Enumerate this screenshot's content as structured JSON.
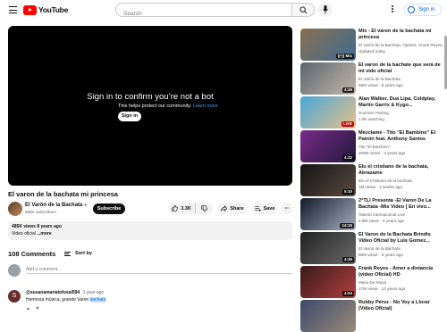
{
  "header": {
    "logo_text": "YouTube",
    "search_placeholder": "Search",
    "signin_label": "Sign in"
  },
  "player": {
    "title": "Sign in to confirm you’re not a bot",
    "message": "This helps protect our community.",
    "learn_more": "Learn more",
    "signin_label": "Sign in"
  },
  "video": {
    "title": "El varon de la bachata mi princesa",
    "channel": "El Varón de la Bachata",
    "subscribers": "566K subscribers",
    "subscribe_label": "Subscribe",
    "likes": "3.3K",
    "share_label": "Share",
    "save_label": "Save",
    "views_date": "485K views  8 years ago",
    "description": "Video oficial",
    "more_label": "...more"
  },
  "comments": {
    "count_label": "108 Comments",
    "sort_label": "Sort by",
    "add_placeholder": "Add a comment...",
    "first": {
      "avatar_letter": "S",
      "author": "@susanamariatofosal594",
      "time": "1 year ago",
      "text": "Hermosa música, grande Varon",
      "highlight": "bachata"
    }
  },
  "recommendations": [
    {
      "title": "Mix - El varon de la bachata mi princesa",
      "channel": "El Varón de la Bachata, Optimiz, Frank Reyes, and more",
      "meta": "Updated today",
      "duration": "((•)) Mix",
      "live": false,
      "colors": [
        "#8a6f52",
        "#3d6b8f"
      ]
    },
    {
      "title": "El varon de la bachate que será de mi vido oficial",
      "channel": "El Varón de la Bachata",
      "meta": "89M views · 9 years ago",
      "duration": "4:39",
      "live": false,
      "colors": [
        "#5a6470",
        "#c5b8a6"
      ]
    },
    {
      "title": "Alan Walker, Dua Lipa, Coldplay, Martin Garrix & Kygo...",
      "channel": "Summer Feeling",
      "meta": "1.9K watching",
      "duration": "LIVE",
      "live": true,
      "colors": [
        "#49a7d8",
        "#e6c08a"
      ]
    },
    {
      "title": "Mézclame - Tito \"El Bambino\" El Patrón feat. Anthony Santos",
      "channel": "Tito \"El Bambino\"",
      "meta": "308M views · 4 years ago",
      "duration": "4:32",
      "live": false,
      "colors": [
        "#7a2a8a",
        "#20193a"
      ]
    },
    {
      "title": "Elu el cristiano de la bachata, Abrazame",
      "channel": "Elu el Cristiano de la bachata",
      "meta": "1M views · 2 weeks ago",
      "duration": "5:10",
      "live": false,
      "colors": [
        "#141414",
        "#5a4a40"
      ]
    },
    {
      "title": "2°TLI Presenta -El Varon De La Bachata -Mis Video [ En vivo...",
      "channel": "Talento Internacional Live",
      "meta": "4.9M views · 9 years ago",
      "duration": "14:15",
      "live": false,
      "colors": [
        "#101a2a",
        "#a8b0c0"
      ]
    },
    {
      "title": "El Varon de la Bachata Brindis Video Oficial by Luis Gomez...",
      "channel": "El Varón de la Bachata",
      "meta": "85M views · 8 years ago",
      "duration": "4:35",
      "live": false,
      "colors": [
        "#222222",
        "#6a6a6a"
      ]
    },
    {
      "title": "Frank Reyes - Amor a distancia (video Oficial) HD",
      "channel": "Mario De Moya",
      "meta": "17M views · 13 years ago",
      "duration": "4:04",
      "live": false,
      "colors": [
        "#3a1a1a",
        "#b04040"
      ]
    },
    {
      "title": "Rubby Pérez - No Voy a Llorar (Video Oficial)",
      "channel": "",
      "meta": "",
      "duration": "",
      "live": false,
      "colors": [
        "#3a4a6a",
        "#9a8a7a"
      ]
    }
  ]
}
